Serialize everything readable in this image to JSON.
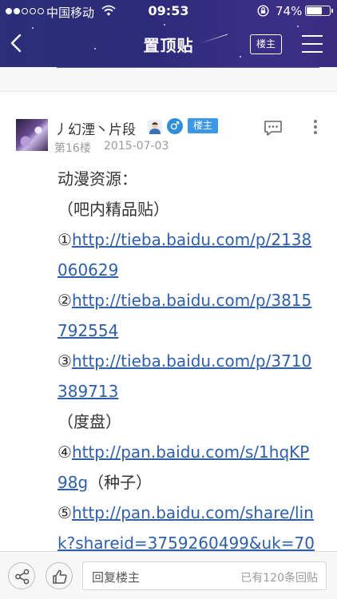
{
  "status_bar": {
    "carrier": "中国移动",
    "time": "09:53",
    "battery_percent": "74%",
    "battery_level": 0.74,
    "signal_bars_filled": 2,
    "signal_bars_total": 5
  },
  "nav": {
    "title": "置顶贴",
    "owner_button": "楼主",
    "icons": {
      "back": "back-chevron-icon",
      "menu": "menu-icon"
    }
  },
  "post": {
    "username": "丿幻湮丶片段",
    "owner_badge": "楼主",
    "gender_symbol": "♂",
    "floor": "第16楼",
    "date": "2015-07-03",
    "icons": {
      "user": "user-icon",
      "comment": "comment-icon",
      "more": "more-icon"
    },
    "lines": {
      "l1": "动漫资源：",
      "l2": "（吧内精品贴）",
      "l3_prefix": "①",
      "l3_link": "http://tieba.baidu.com/p/2138",
      "l4_link": "060629",
      "l5_prefix": "②",
      "l5_link": "http://tieba.baidu.com/p/3815",
      "l6_link": "792554",
      "l7_prefix": "③",
      "l7_link": "http://tieba.baidu.com/p/3710",
      "l8_link": "389713",
      "l9": "（度盘）",
      "l10_prefix": "④",
      "l10_link": "http://pan.baidu.com/s/1hqKP",
      "l11_link": "98g",
      "l11_suffix": "（种子）",
      "l12_prefix": "⑤",
      "l12_link": "http://pan.baidu.com/share/lin",
      "l13_link": "k?shareid=3759260499&uk=70"
    }
  },
  "bottom_bar": {
    "reply_placeholder": "回复楼主",
    "reply_count": "已有120条回贴",
    "icons": {
      "share": "share-icon",
      "like": "thumbs-up-icon"
    }
  },
  "colors": {
    "header": "#2e2a7a",
    "link": "#2e5fa8",
    "badge": "#3b98e6",
    "gender": "#2f8ed9"
  }
}
